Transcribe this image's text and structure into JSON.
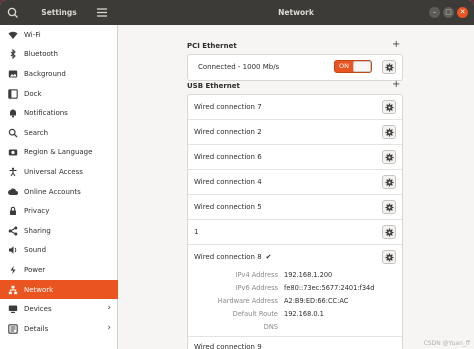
{
  "titlebar": {
    "app_title": "Settings",
    "page_title": "Network"
  },
  "sidebar": {
    "items": [
      {
        "label": "Wi-Fi",
        "icon": "wifi-icon"
      },
      {
        "label": "Bluetooth",
        "icon": "bluetooth-icon"
      },
      {
        "label": "Background",
        "icon": "background-icon"
      },
      {
        "label": "Dock",
        "icon": "dock-icon"
      },
      {
        "label": "Notifications",
        "icon": "notifications-icon"
      },
      {
        "label": "Search",
        "icon": "search-icon"
      },
      {
        "label": "Region & Language",
        "icon": "camera-icon"
      },
      {
        "label": "Universal Access",
        "icon": "accessibility-icon"
      },
      {
        "label": "Online Accounts",
        "icon": "accounts-icon"
      },
      {
        "label": "Privacy",
        "icon": "privacy-icon"
      },
      {
        "label": "Sharing",
        "icon": "sharing-icon"
      },
      {
        "label": "Sound",
        "icon": "sound-icon"
      },
      {
        "label": "Power",
        "icon": "power-icon"
      },
      {
        "label": "Network",
        "icon": "network-icon",
        "active": true
      },
      {
        "label": "Devices",
        "icon": "devices-icon"
      },
      {
        "label": "Details",
        "icon": "details-icon"
      }
    ]
  },
  "pci": {
    "title": "PCI Ethernet",
    "status": "Connected - 1000 Mb/s",
    "toggle_label": "ON"
  },
  "usb": {
    "title": "USB Ethernet",
    "connections": [
      "Wired connection 7",
      "Wired connection 2",
      "Wired connection 6",
      "Wired connection 4",
      "Wired connection 5",
      "1"
    ],
    "active_connection": {
      "label": "Wired connection 8",
      "details": [
        {
          "key": "IPv4 Address",
          "value": "192.168.1.200"
        },
        {
          "key": "IPv6 Address",
          "value": "fe80::73ec:5677:2401:f34d"
        },
        {
          "key": "Hardware Address",
          "value": "A2:B9:ED:66:CC:AC"
        },
        {
          "key": "Default Route",
          "value": "192.168.0.1"
        },
        {
          "key": "DNS",
          "value": ""
        }
      ]
    },
    "partial_row": "Wired connection 9"
  },
  "watermark": "CSDN @Yuan_ff",
  "colors": {
    "accent": "#e95420",
    "titlebar": "#3c3b37"
  }
}
